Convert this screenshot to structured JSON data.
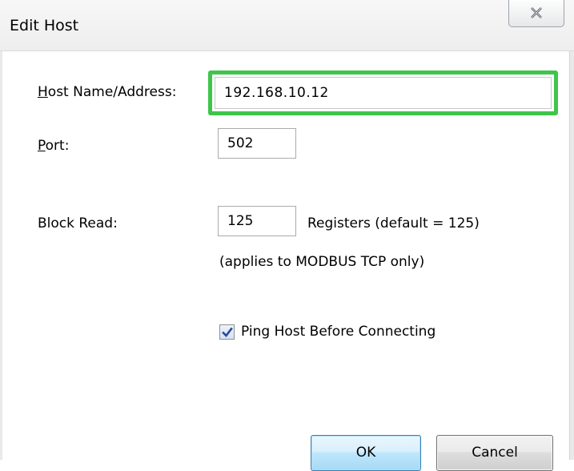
{
  "window": {
    "title": "Edit Host",
    "close_glyph": "close-icon"
  },
  "fields": {
    "host": {
      "label_underlined": "H",
      "label_rest": "ost Name/Address:",
      "value": "192.168.10.12"
    },
    "port": {
      "label_underlined": "P",
      "label_rest": "ort:",
      "value": "502"
    },
    "block_read": {
      "label": "Block Read:",
      "value": "125",
      "suffix": "Registers (default = 125)",
      "note": "(applies to MODBUS TCP only)"
    }
  },
  "ping": {
    "label": "Ping Host Before Connecting",
    "checked": true
  },
  "buttons": {
    "ok": "OK",
    "cancel": "Cancel"
  },
  "colors": {
    "highlight": "#3fc54b",
    "ok_border": "#3c7fb1"
  }
}
